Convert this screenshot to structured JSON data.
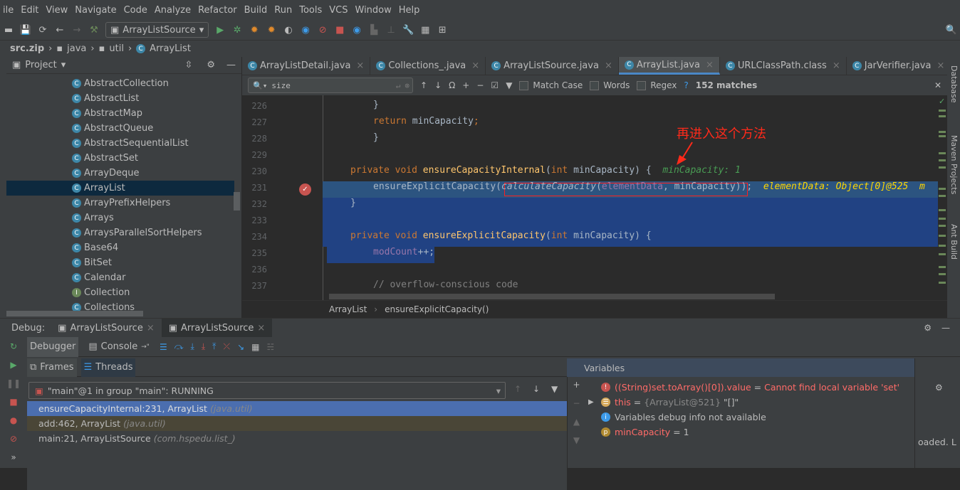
{
  "menu": [
    "ile",
    "Edit",
    "View",
    "Navigate",
    "Code",
    "Analyze",
    "Refactor",
    "Build",
    "Run",
    "Tools",
    "VCS",
    "Window",
    "Help"
  ],
  "toolbar": {
    "run_config": "ArrayListSource"
  },
  "breadcrumb": [
    "src.zip",
    "java",
    "util",
    "ArrayList"
  ],
  "project": {
    "title": "Project",
    "items": [
      {
        "label": "AbstractCollection",
        "icon": "class-locked"
      },
      {
        "label": "AbstractList",
        "icon": "class-locked"
      },
      {
        "label": "AbstractMap",
        "icon": "class"
      },
      {
        "label": "AbstractQueue",
        "icon": "class"
      },
      {
        "label": "AbstractSequentialList",
        "icon": "class"
      },
      {
        "label": "AbstractSet",
        "icon": "class"
      },
      {
        "label": "ArrayDeque",
        "icon": "class"
      },
      {
        "label": "ArrayList",
        "icon": "class",
        "selected": true
      },
      {
        "label": "ArrayPrefixHelpers",
        "icon": "class"
      },
      {
        "label": "Arrays",
        "icon": "class"
      },
      {
        "label": "ArraysParallelSortHelpers",
        "icon": "class"
      },
      {
        "label": "Base64",
        "icon": "class"
      },
      {
        "label": "BitSet",
        "icon": "class"
      },
      {
        "label": "Calendar",
        "icon": "class"
      },
      {
        "label": "Collection",
        "icon": "interface"
      },
      {
        "label": "Collections",
        "icon": "class"
      }
    ]
  },
  "tabs": [
    {
      "label": "ArrayListDetail.java"
    },
    {
      "label": "Collections_.java"
    },
    {
      "label": "ArrayListSource.java"
    },
    {
      "label": "ArrayList.java",
      "active": true
    },
    {
      "label": "URLClassPath.class"
    },
    {
      "label": "JarVerifier.java"
    }
  ],
  "find": {
    "query": "size",
    "match_case": "Match Case",
    "words": "Words",
    "regex": "Regex",
    "help": "?",
    "matches": "152 matches"
  },
  "code": {
    "lines": [
      {
        "n": "226",
        "t": [
          [
            "}",
            ""
          ]
        ]
      },
      {
        "n": "227",
        "t": [
          [
            "return ",
            "kw"
          ],
          [
            "minCapacity",
            ""
          ],
          [
            ";",
            "kw"
          ]
        ]
      },
      {
        "n": "228",
        "t": [
          [
            "}",
            ""
          ]
        ]
      },
      {
        "n": "229",
        "t": []
      },
      {
        "n": "230",
        "t": [
          [
            "private void ",
            "kw"
          ],
          [
            "ensureCapacityInternal",
            "fn"
          ],
          [
            "(",
            ""
          ],
          [
            "int ",
            "kw"
          ],
          [
            "minCapacity) {  ",
            ""
          ],
          [
            "minCapacity: 1",
            "hint"
          ]
        ]
      },
      {
        "n": "231",
        "t": [
          [
            "ensureExplicitCapacity(",
            ""
          ],
          [
            "calculateCapacity",
            "it"
          ],
          [
            "(",
            ""
          ],
          [
            "elementData",
            ""
          ],
          [
            ", minCapacity));  ",
            ""
          ],
          [
            "elementData: Object[0]@525  m",
            ""
          ]
        ]
      },
      {
        "n": "232",
        "t": [
          [
            "}",
            ""
          ]
        ]
      },
      {
        "n": "233",
        "t": []
      },
      {
        "n": "234",
        "t": [
          [
            "private void ",
            "kw"
          ],
          [
            "ensureExplicitCapacity",
            "fn"
          ],
          [
            "(",
            ""
          ],
          [
            "int ",
            "kw"
          ],
          [
            "minCapacity) {",
            ""
          ]
        ]
      },
      {
        "n": "235",
        "t": [
          [
            "modCount",
            "fld"
          ],
          [
            "++;",
            ""
          ]
        ]
      },
      {
        "n": "236",
        "t": []
      },
      {
        "n": "237",
        "t": [
          [
            "// overflow-conscious code",
            "cm"
          ]
        ]
      }
    ]
  },
  "annotation": "再进入这个方法",
  "editor_breadcrumb": [
    "ArrayList",
    "ensureExplicitCapacity()"
  ],
  "right_tools": [
    "Database",
    "Maven Projects",
    "Ant Build"
  ],
  "debug": {
    "label": "Debug:",
    "sessions": [
      "ArrayListSource",
      "ArrayListSource"
    ],
    "debugger_tab": "Debugger",
    "console_tab": "Console",
    "frames_tab": "Frames",
    "threads_tab": "Threads",
    "thread": "\"main\"@1 in group \"main\": RUNNING",
    "frames": [
      {
        "method": "ensureCapacityInternal:231, ArrayList",
        "pkg": "(java.util)"
      },
      {
        "method": "add:462, ArrayList",
        "pkg": "(java.util)"
      },
      {
        "method": "main:21, ArrayListSource",
        "pkg": "(com.hspedu.list_)"
      }
    ],
    "variables_title": "Variables",
    "variables": [
      {
        "name": "((String)set.toArray()[0]).value",
        "eq": " = ",
        "value": "Cannot find local variable 'set'"
      },
      {
        "name": "this",
        "eq": " = ",
        "value": "{ArrayList@521}",
        "extra": " \"[]\""
      },
      {
        "name": "",
        "eq": "",
        "value": "Variables debug info not available"
      },
      {
        "name": "minCapacity",
        "eq": " = ",
        "value": "1"
      }
    ],
    "side_text": "oaded. L"
  }
}
